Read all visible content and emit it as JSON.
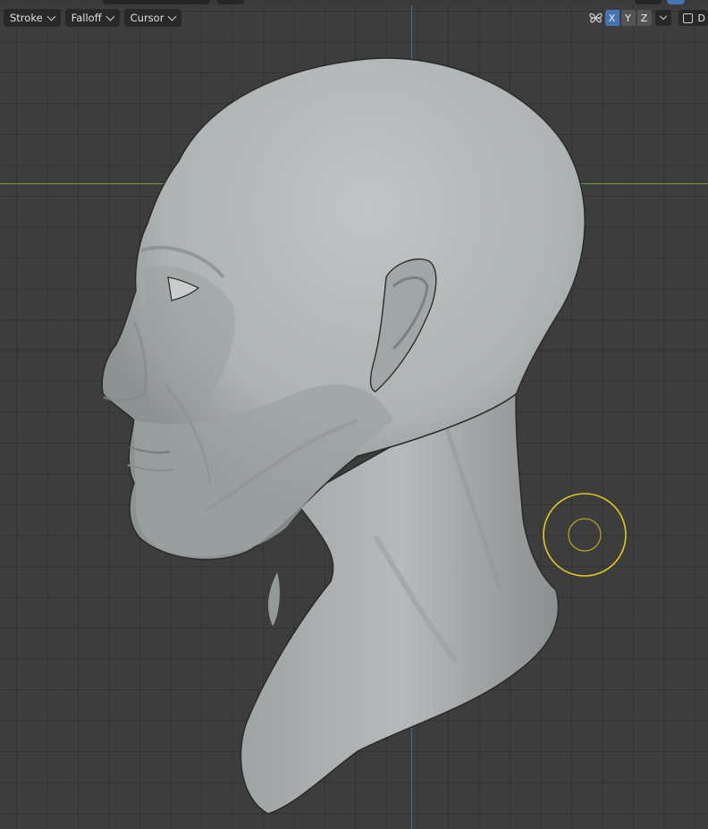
{
  "toolbar": {
    "stroke_label": "Stroke",
    "falloff_label": "Falloff",
    "cursor_label": "Cursor"
  },
  "symmetry": {
    "x_label": "X",
    "y_label": "Y",
    "z_label": "Z",
    "active_axis": "X",
    "extra_label": "D"
  },
  "icons": {
    "symmetry": "butterfly-symmetry-icon",
    "dropdown": "chevron-down-icon",
    "brush": "brush-cursor-circle"
  },
  "colors": {
    "background": "#3d3d3d",
    "x_axis": "#7a9a3a",
    "y_axis": "#3d6cb0",
    "active": "#4772b3",
    "brush": "#e2c91e",
    "mesh": "#a9aeae"
  }
}
